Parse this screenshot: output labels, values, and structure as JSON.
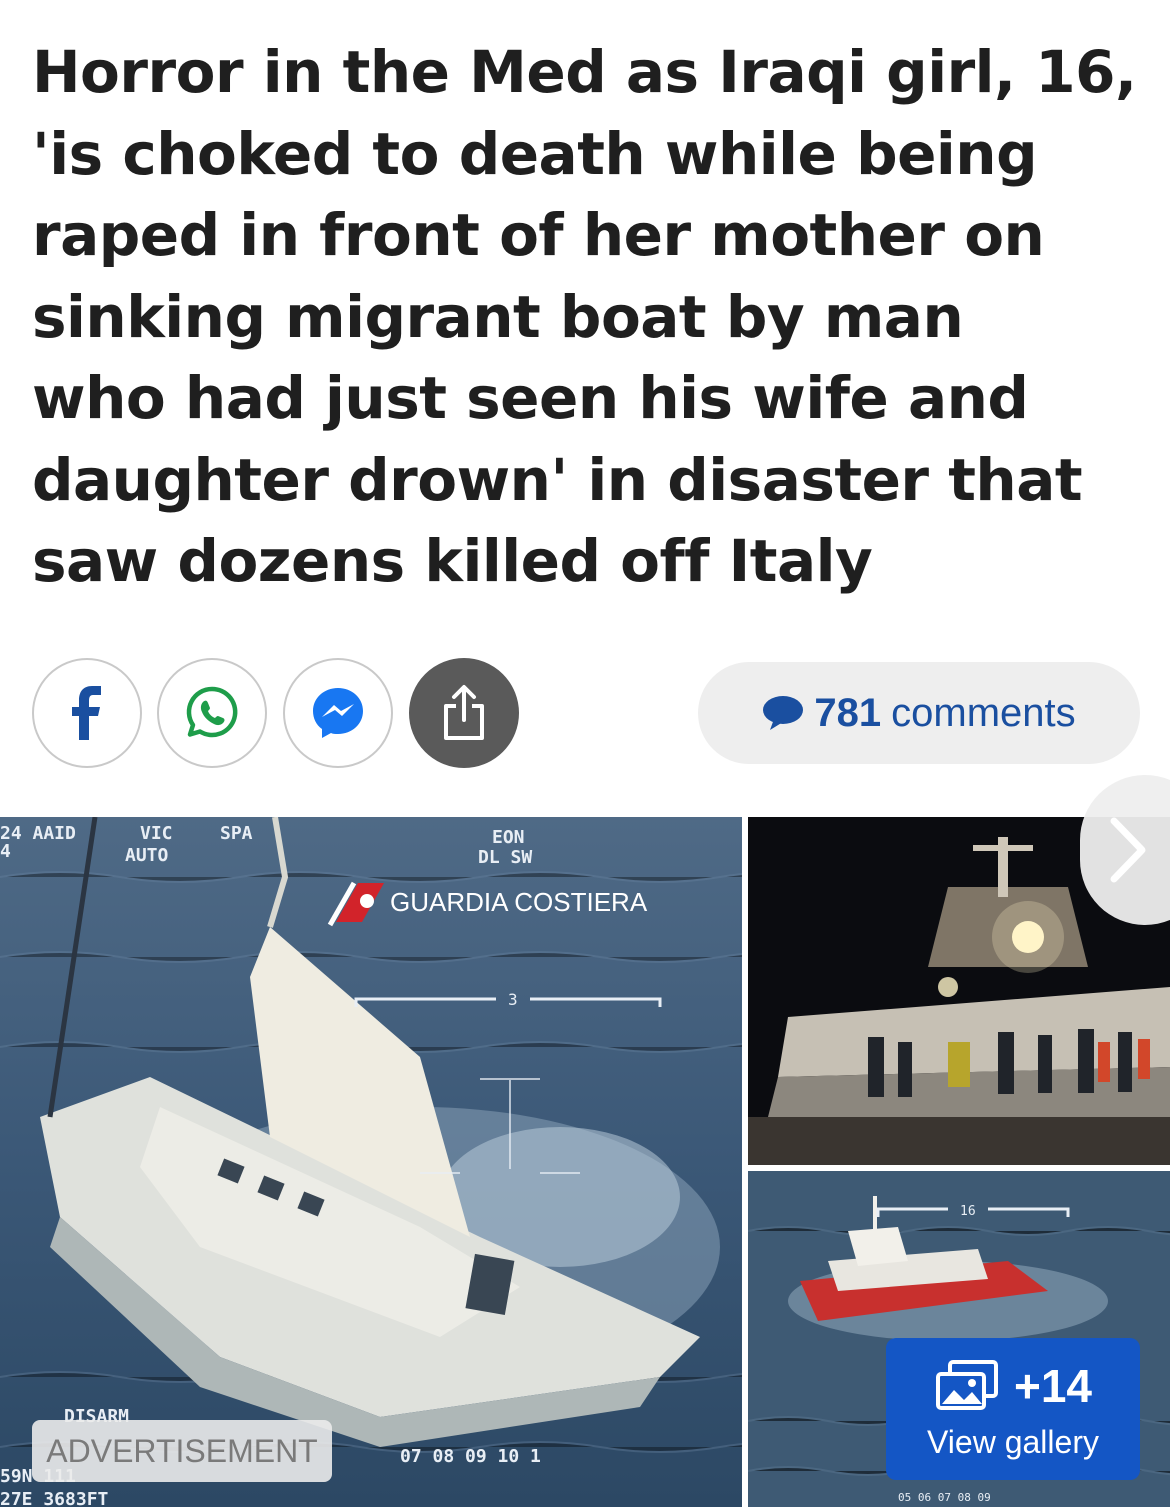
{
  "article": {
    "headline_lines": [
      "Horror in the Med as Iraqi girl, 16,",
      "'is choked to death while being",
      "raped in front of her mother on",
      "sinking migrant boat by man",
      "who had just seen his wife and",
      "daughter drown' in disaster that",
      "saw dozens killed off Italy"
    ]
  },
  "share": {
    "buttons": [
      {
        "name": "facebook",
        "icon": "facebook-icon"
      },
      {
        "name": "whatsapp",
        "icon": "whatsapp-icon"
      },
      {
        "name": "messenger",
        "icon": "messenger-icon"
      },
      {
        "name": "share",
        "icon": "share-icon"
      }
    ],
    "comments_count": "781",
    "comments_label": "comments"
  },
  "gallery": {
    "main_photo": {
      "hud_top": [
        "24 AAID",
        "VIC",
        "AUTO",
        "SPA",
        "EON",
        "DL SW"
      ],
      "overlay_brand": "GUARDIA COSTIERA",
      "scale_label": "3",
      "hud_bottom": [
        "DISARM",
        "07 08 09 10 1"
      ],
      "hud_left": [
        "4",
        "59N 111",
        "27E 3683FT"
      ]
    },
    "bottom_right_photo": {
      "scale_label": "16",
      "hud_bottom": "05 06 07 08 09"
    },
    "extra_count": "+14",
    "view_label": "View gallery",
    "ad_label": "ADVERTISEMENT"
  },
  "colors": {
    "headline": "#1f1f1f",
    "link_blue": "#1a4fa0",
    "facebook_blue": "#1a4fa0",
    "whatsapp_green": "#1e9d4a",
    "messenger_blue": "#1877f2",
    "gallery_button": "#1456c5",
    "coast_guard_red": "#d2232a"
  }
}
